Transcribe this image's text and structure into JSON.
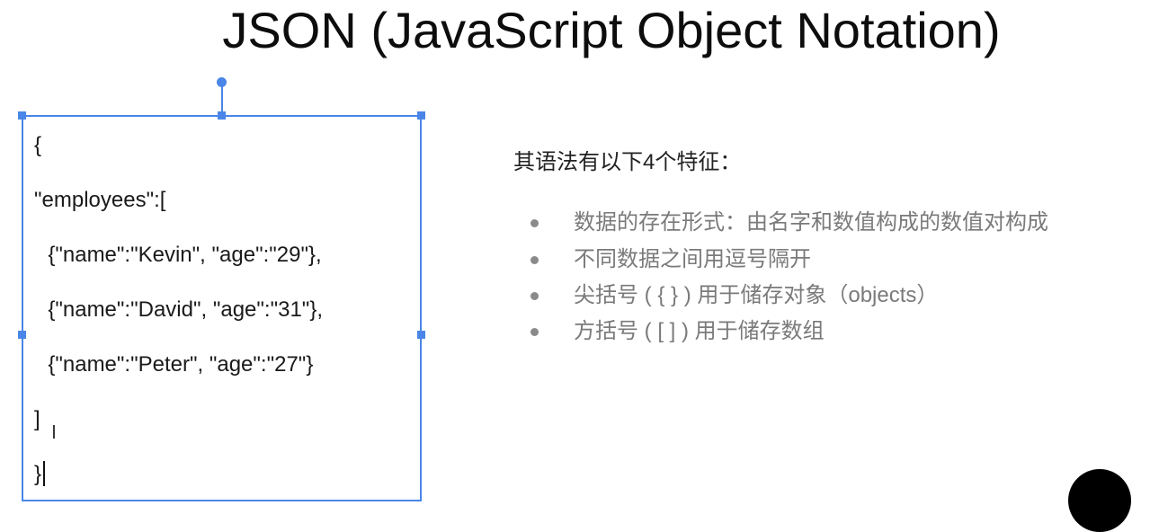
{
  "slide": {
    "title": "JSON (JavaScript Object Notation)"
  },
  "code_box": {
    "lines": [
      "{",
      "\"employees\":[",
      "  {\"name\":\"Kevin\", \"age\":\"29\"},",
      "  {\"name\":\"David\", \"age\":\"31\"},",
      "  {\"name\":\"Peter\", \"age\":\"27\"}",
      "]",
      "}"
    ]
  },
  "syntax": {
    "intro": "其语法有以下4个特征：",
    "bullets": [
      "数据的存在形式：由名字和数值构成的数值对构成",
      "不同数据之间用逗号隔开",
      "尖括号 ( { } ) 用于储存对象（objects）",
      "方括号 ( [ ] ) 用于储存数组"
    ]
  },
  "colors": {
    "selection": "#4a86e8",
    "bullet_text": "#7a7a7a",
    "title_text": "#0d0d0d"
  },
  "icons": {
    "text_cursor": "i-beam-cursor-icon"
  }
}
